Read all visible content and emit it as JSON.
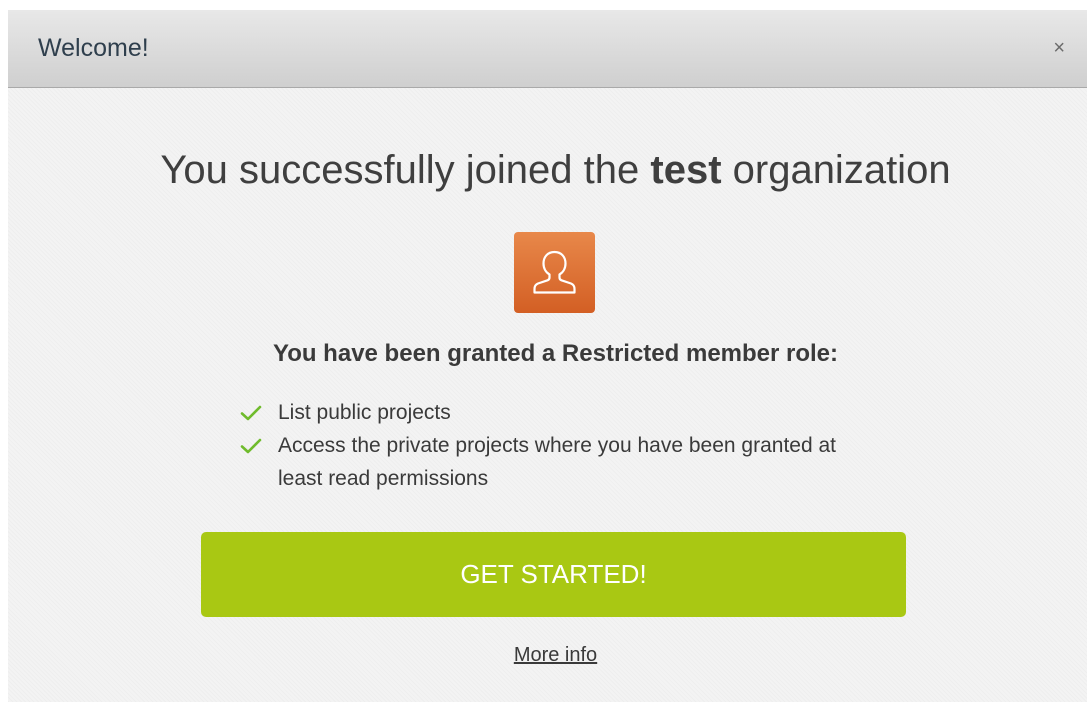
{
  "modal": {
    "title": "Welcome!",
    "close_label": "×"
  },
  "content": {
    "headline_prefix": "You successfully joined the ",
    "organization_name": "test",
    "headline_suffix": " organization",
    "avatar_icon": "user-icon",
    "role_text": "You have been granted a Restricted member role:",
    "permissions": [
      "List public projects",
      "Access the private projects where you have been granted at least read permissions"
    ],
    "cta_label": "GET STARTED!",
    "more_info_label": "More info"
  },
  "colors": {
    "accent": "#a9c813",
    "icon_gradient_top": "#e8884a",
    "icon_gradient_bottom": "#d35f24",
    "check_green": "#6fbb2c"
  }
}
